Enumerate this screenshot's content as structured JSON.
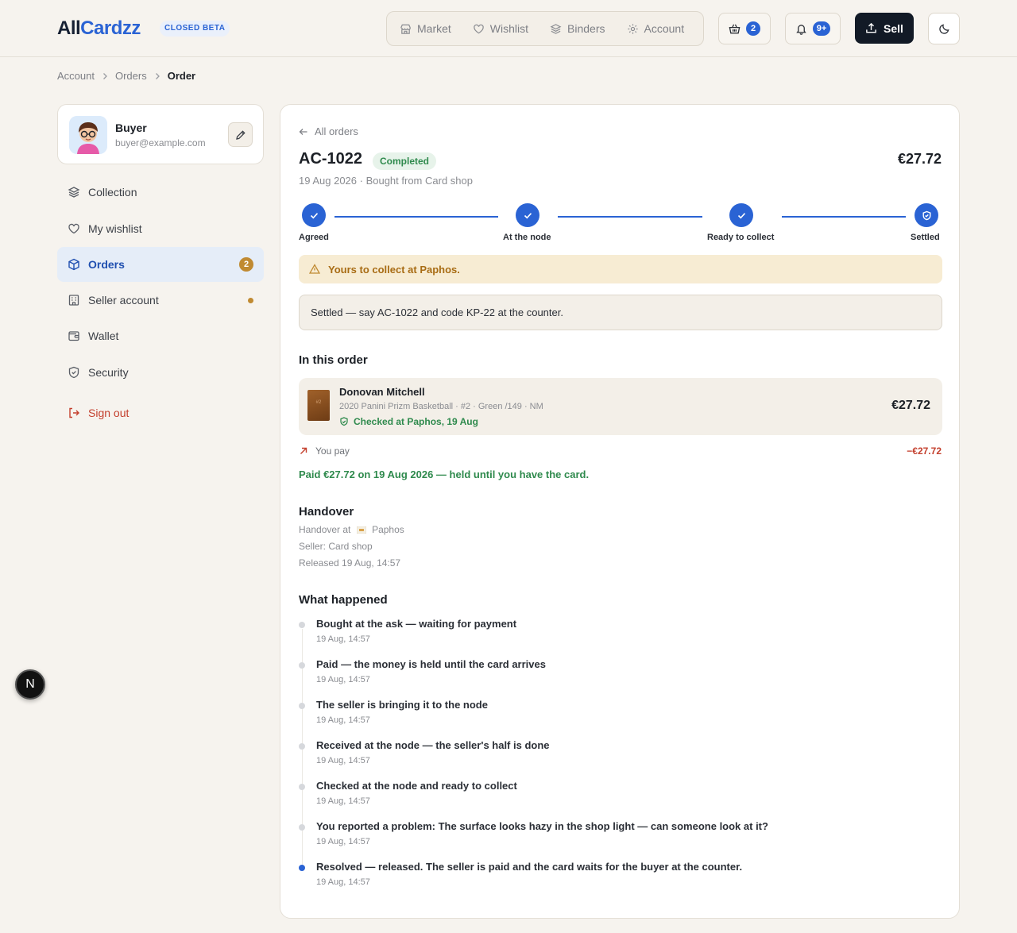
{
  "header": {
    "logo_part1": "All",
    "logo_part2": "Cardzz",
    "beta": "CLOSED BETA",
    "nav": [
      {
        "label": "Market",
        "icon": "store-icon"
      },
      {
        "label": "Wishlist",
        "icon": "heart-icon"
      },
      {
        "label": "Binders",
        "icon": "layers-icon"
      },
      {
        "label": "Account",
        "icon": "gear-icon"
      }
    ],
    "cart_count": "2",
    "notif_count": "9+",
    "sell_label": "Sell"
  },
  "breadcrumb": [
    "Account",
    "Orders",
    "Order"
  ],
  "profile": {
    "name": "Buyer",
    "email": "buyer@example.com"
  },
  "sidebar": {
    "items": [
      {
        "label": "Collection"
      },
      {
        "label": "My wishlist"
      },
      {
        "label": "Orders",
        "badge": "2"
      },
      {
        "label": "Seller account"
      },
      {
        "label": "Wallet"
      },
      {
        "label": "Security"
      },
      {
        "label": "Sign out"
      }
    ]
  },
  "fab_label": "N",
  "order": {
    "back_label": "All orders",
    "id": "AC-1022",
    "status": "Completed",
    "total": "€27.72",
    "subtitle": "19 Aug 2026 · Bought from Card shop",
    "steps": [
      "Agreed",
      "At the node",
      "Ready to collect",
      "Settled"
    ],
    "alert": "Yours to collect at Paphos.",
    "code_note": "Settled — say AC-1022 and code KP-22 at the counter.",
    "items_title": "In this order",
    "item": {
      "thumb_label": "#2",
      "name": "Donovan Mitchell",
      "meta": "2020 Panini Prizm Basketball · #2 · Green /149 · NM",
      "check": "Checked at Paphos, 19 Aug",
      "price": "€27.72"
    },
    "you_pay_label": "You pay",
    "you_pay_amount": "−€27.72",
    "paid_note": "Paid €27.72 on 19 Aug 2026 — held until you have the card.",
    "handover": {
      "title": "Handover",
      "location_prefix": "Handover at",
      "location": "Paphos",
      "seller": "Seller: Card shop",
      "released": "Released 19 Aug, 14:57"
    },
    "timeline_title": "What happened",
    "timeline": [
      {
        "title": "Bought at the ask — waiting for payment",
        "time": "19 Aug, 14:57"
      },
      {
        "title": "Paid — the money is held until the card arrives",
        "time": "19 Aug, 14:57"
      },
      {
        "title": "The seller is bringing it to the node",
        "time": "19 Aug, 14:57"
      },
      {
        "title": "Received at the node — the seller's half is done",
        "time": "19 Aug, 14:57"
      },
      {
        "title": "Checked at the node and ready to collect",
        "time": "19 Aug, 14:57"
      },
      {
        "title": "You reported a problem: The surface looks hazy in the shop light — can someone look at it?",
        "time": "19 Aug, 14:57"
      },
      {
        "title": "Resolved — released. The seller is paid and the card waits for the buyer at the counter.",
        "time": "19 Aug, 14:57"
      }
    ]
  },
  "colors": {
    "accent": "#2a63d4",
    "success": "#2f8a4d",
    "warning": "#a86c14",
    "danger": "#c4402e",
    "background": "#f6f3ee"
  }
}
